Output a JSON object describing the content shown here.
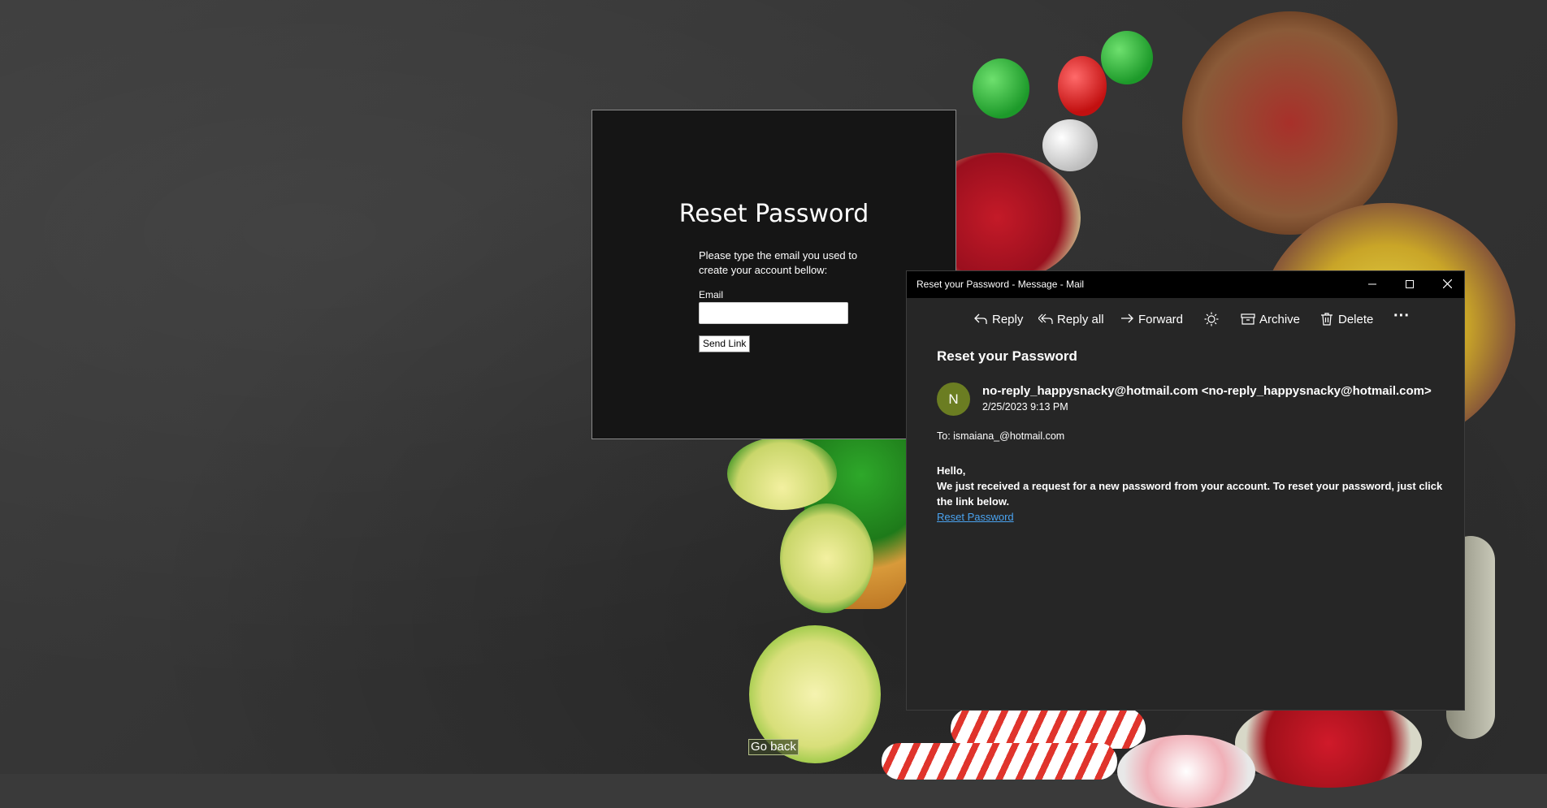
{
  "reset_card": {
    "title": "Reset Password",
    "description": "Please type the email you used to create your account bellow:",
    "email_label": "Email",
    "email_value": "",
    "send_button": "Send Link"
  },
  "go_back": "Go back",
  "mail_window": {
    "title": "Reset your Password - Message - Mail",
    "controls": {
      "minimize": "minimize-icon",
      "maximize": "maximize-icon",
      "close": "close-icon"
    },
    "toolbar": {
      "reply": "Reply",
      "reply_all": "Reply all",
      "forward": "Forward",
      "archive": "Archive",
      "delete": "Delete",
      "more": "···"
    },
    "subject": "Reset your Password",
    "avatar_initial": "N",
    "avatar_color": "#6b7d22",
    "sender": "no-reply_happysnacky@hotmail.com  <no-reply_happysnacky@hotmail.com>",
    "date": "2/25/2023 9:13 PM",
    "to": "To: ismaiana_@hotmail.com",
    "body_greeting": "Hello,",
    "body_text": "We just received a request for a new password from your account. To reset your password, just click the link below.",
    "link_text": "Reset Password",
    "link_color": "#4aa3f0"
  }
}
